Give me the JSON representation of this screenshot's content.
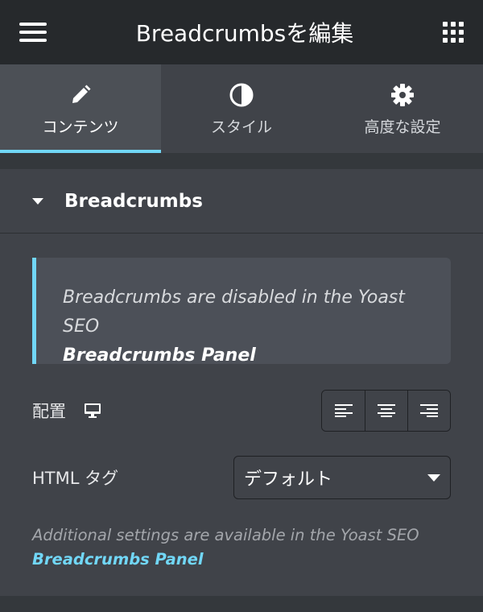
{
  "header": {
    "title": "Breadcrumbsを編集",
    "menu_icon": "hamburger-icon",
    "apps_icon": "grid-icon"
  },
  "tabs": [
    {
      "label": "コンテンツ",
      "icon": "pencil-icon",
      "active": true
    },
    {
      "label": "スタイル",
      "icon": "half-circle-icon",
      "active": false
    },
    {
      "label": "高度な設定",
      "icon": "gear-icon",
      "active": false
    }
  ],
  "section": {
    "title": "Breadcrumbs",
    "expanded": true
  },
  "notice": {
    "text": "Breadcrumbs are disabled in the Yoast SEO",
    "emphasis": "Breadcrumbs Panel"
  },
  "alignment": {
    "label": "配置",
    "device_icon": "desktop-monitor-icon",
    "options": [
      "align-left-icon",
      "align-center-icon",
      "align-right-icon"
    ]
  },
  "html_tag": {
    "label": "HTML タグ",
    "selected": "デフォルト"
  },
  "additional": {
    "text": "Additional settings are available in the Yoast SEO",
    "link": "Breadcrumbs Panel"
  },
  "colors": {
    "accent": "#71d7f7",
    "header_bg": "#26292c",
    "panel_bg": "#404349"
  }
}
